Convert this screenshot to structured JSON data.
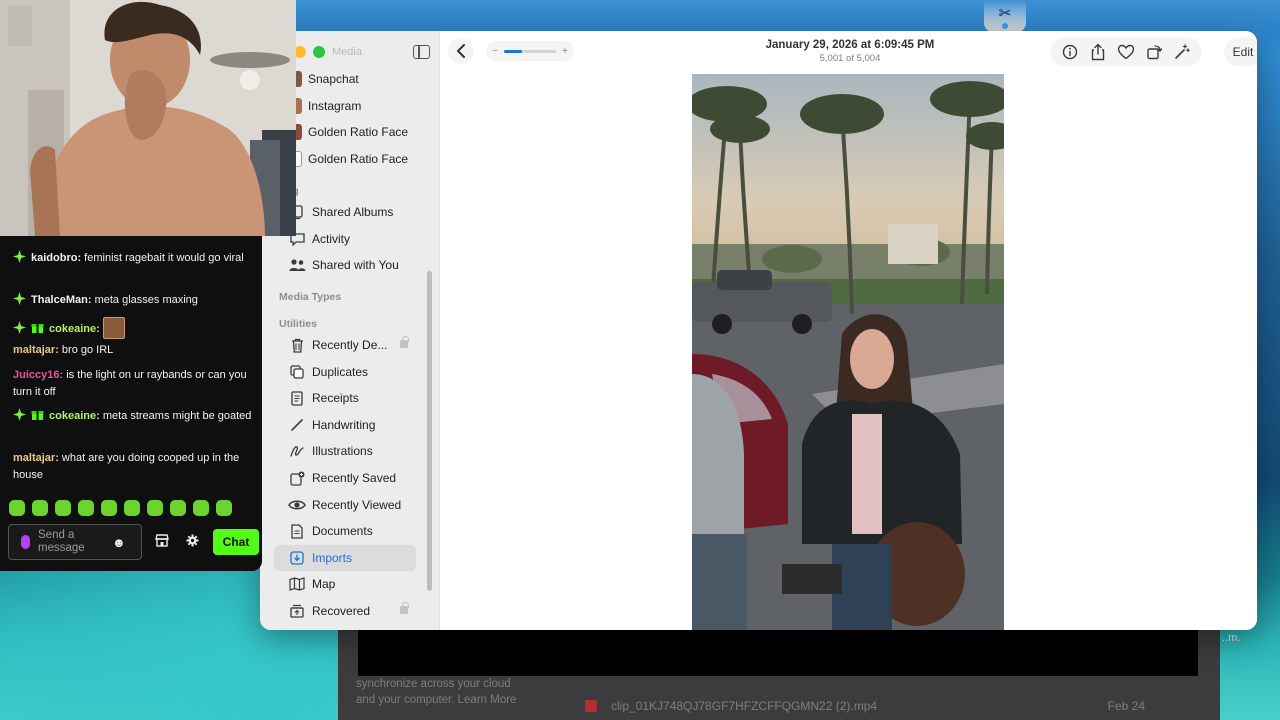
{
  "desktop": {
    "dock_app_glyph": "✂"
  },
  "background_window": {
    "side_text": "synchronize across your cloud and your computer. Learn More",
    "file_name": "clip_01KJ748QJ78GF7HFZCFFQGMN22 (2).mp4",
    "file_date": "Feb 24",
    "corner_text": "..m."
  },
  "photos": {
    "window_title_faded": "Media",
    "sidebar": {
      "items_top": [
        {
          "label": "Snapchat",
          "thumb_color": "#7a5a48"
        },
        {
          "label": "Instagram",
          "thumb_color": "#a86f52"
        },
        {
          "label": "Golden Ratio Face",
          "thumb_color": "#8a4d3c"
        },
        {
          "label": "Golden Ratio Face",
          "thumb_color": "#ffffff"
        }
      ],
      "sharing_heading": "ring",
      "sharing_items": [
        "Shared Albums",
        "Activity",
        "Shared with You"
      ],
      "media_types_heading": "Media Types",
      "utilities_heading": "Utilities",
      "utilities": [
        {
          "label": "Recently De...",
          "locked": true
        },
        {
          "label": "Duplicates"
        },
        {
          "label": "Receipts"
        },
        {
          "label": "Handwriting"
        },
        {
          "label": "Illustrations"
        },
        {
          "label": "Recently Saved"
        },
        {
          "label": "Recently Viewed"
        },
        {
          "label": "Documents"
        },
        {
          "label": "Imports",
          "active": true
        },
        {
          "label": "Map"
        },
        {
          "label": "Recovered",
          "locked": true
        }
      ]
    },
    "toolbar": {
      "title": "January 29, 2026 at 6:09:45 PM",
      "count": "5,001 of 5,004",
      "zoom_minus": "−",
      "zoom_plus": "+",
      "zoom_level": 0.35,
      "edit_label": "Edit"
    }
  },
  "chat": {
    "messages": [
      {
        "user": "kaidobro",
        "color": "#f2f2f2",
        "badges": [
          "sparkle"
        ],
        "text": "feminist ragebait it would go viral"
      },
      {
        "user": "ThalceMan",
        "color": "#f2f2f2",
        "badges": [
          "sparkle"
        ],
        "text": "meta glasses maxing"
      },
      {
        "user": "cokeaine",
        "color": "#b6f26b",
        "badges": [
          "sparkle",
          "gift"
        ],
        "text": "",
        "emote": true
      },
      {
        "user": "maltajar",
        "color": "#e9c88a",
        "badges": [],
        "text": "bro go IRL"
      },
      {
        "user": "Juiccy16",
        "color": "#e25a9a",
        "badges": [],
        "text": "is the light on ur raybands or can you turn it off"
      },
      {
        "user": "cokeaine",
        "color": "#b6f26b",
        "badges": [
          "sparkle",
          "gift"
        ],
        "text": "meta streams might be goated"
      },
      {
        "user": "maltajar",
        "color": "#e9c88a",
        "badges": [],
        "text": "what are you doing cooped up in the house"
      }
    ],
    "input_placeholder": "Send a message",
    "chat_button": "Chat",
    "accent": "#53fc18"
  }
}
